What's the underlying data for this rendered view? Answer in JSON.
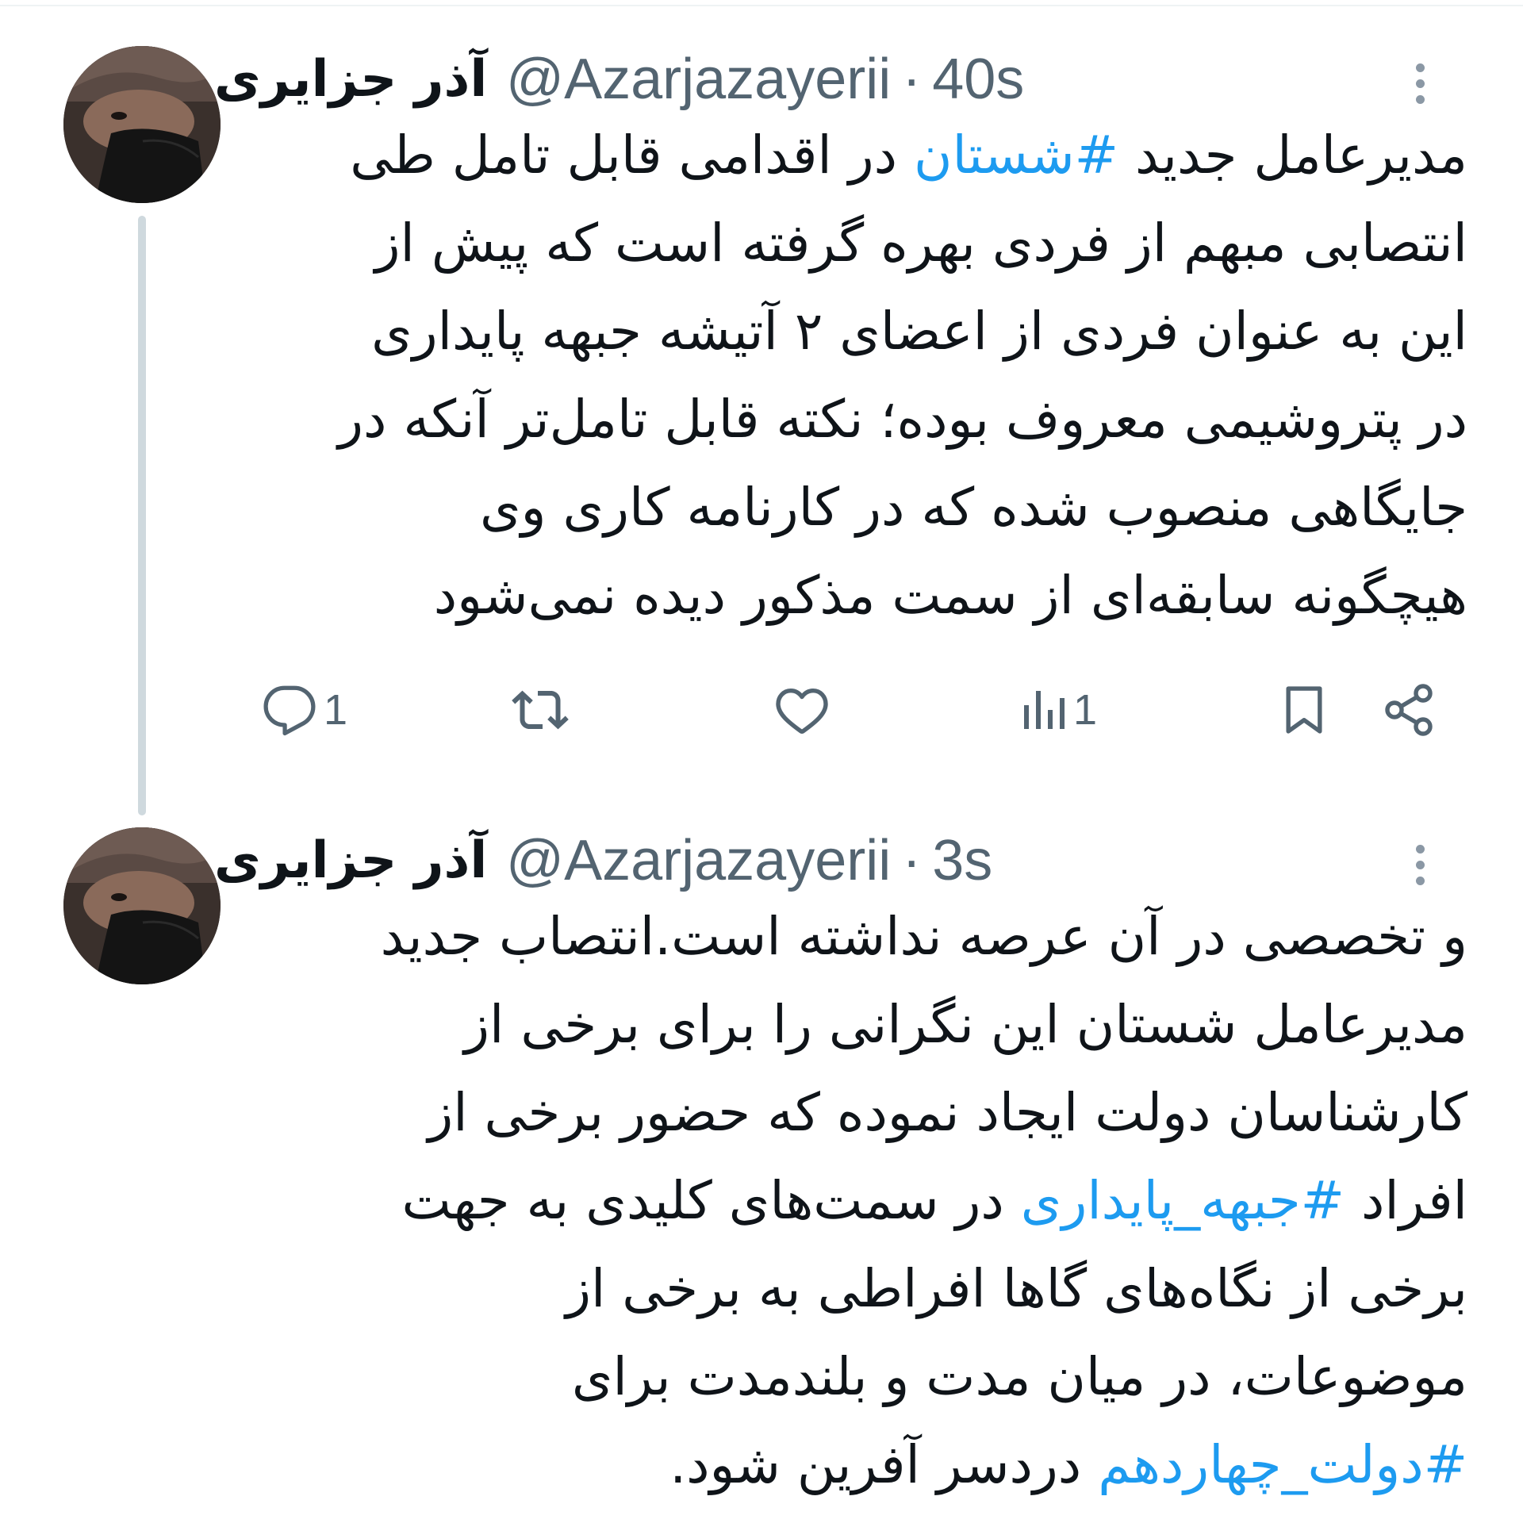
{
  "thread": [
    {
      "author": {
        "display_name": "آذر جزایری",
        "handle": "@Azarjazayerii",
        "time": "40s"
      },
      "body_lines": [
        [
          {
            "text": "مدیرعامل جدید "
          },
          {
            "text": "#شستان",
            "hashtag": true
          },
          {
            "text": " در اقدامی قابل تامل طی"
          }
        ],
        [
          {
            "text": "انتصابی مبهم از فردی بهره گرفته است که پیش از"
          }
        ],
        [
          {
            "text": "این به عنوان فردی از اعضای ۲ آتیشه جبهه پایداری"
          }
        ],
        [
          {
            "text": "در پتروشیمی معروف بوده؛ نکته قابل تامل‌تر آنکه در"
          }
        ],
        [
          {
            "text": "جایگاهی منصوب شده که در کارنامه کاری وی"
          }
        ],
        [
          {
            "text": "هیچگونه سابقه‌ای از سمت مذکور دیده نمی‌شود"
          }
        ]
      ],
      "actions": {
        "reply_count": "1",
        "retweet_count": "",
        "like_count": "",
        "views_count": "1"
      }
    },
    {
      "author": {
        "display_name": "آذر جزایری",
        "handle": "@Azarjazayerii",
        "time": "3s"
      },
      "body_lines": [
        [
          {
            "text": "و تخصصی در آن عرصه نداشته است.انتصاب جدید"
          }
        ],
        [
          {
            "text": "مدیرعامل شستان این نگرانی را برای برخی از"
          }
        ],
        [
          {
            "text": "کارشناسان دولت ایجاد نموده که حضور برخی از"
          }
        ],
        [
          {
            "text": "افراد "
          },
          {
            "text": "#جبهه_پایداری",
            "hashtag": true
          },
          {
            "text": " در سمت‌های کلیدی به جهت"
          }
        ],
        [
          {
            "text": "برخی از نگاه‌های گاها افراطی به برخی از"
          }
        ],
        [
          {
            "text": "موضوعات، در میان مدت و بلندمدت برای"
          }
        ],
        [
          {
            "text": "#دولت_چهاردهم",
            "hashtag": true
          },
          {
            "text": " دردسر آفرین شود."
          }
        ]
      ]
    }
  ],
  "icons": {
    "more": "more-vertical-icon",
    "reply": "reply-bubble-icon",
    "retweet": "retweet-icon",
    "like": "heart-icon",
    "views": "views-bar-chart-icon",
    "bookmark": "bookmark-icon",
    "share": "share-icon"
  },
  "colors": {
    "text_primary": "#0f1419",
    "text_secondary": "#536471",
    "hashtag": "#1d9bf0",
    "thread_line": "#cfd9de",
    "icon_gray": "#8b98a5"
  }
}
